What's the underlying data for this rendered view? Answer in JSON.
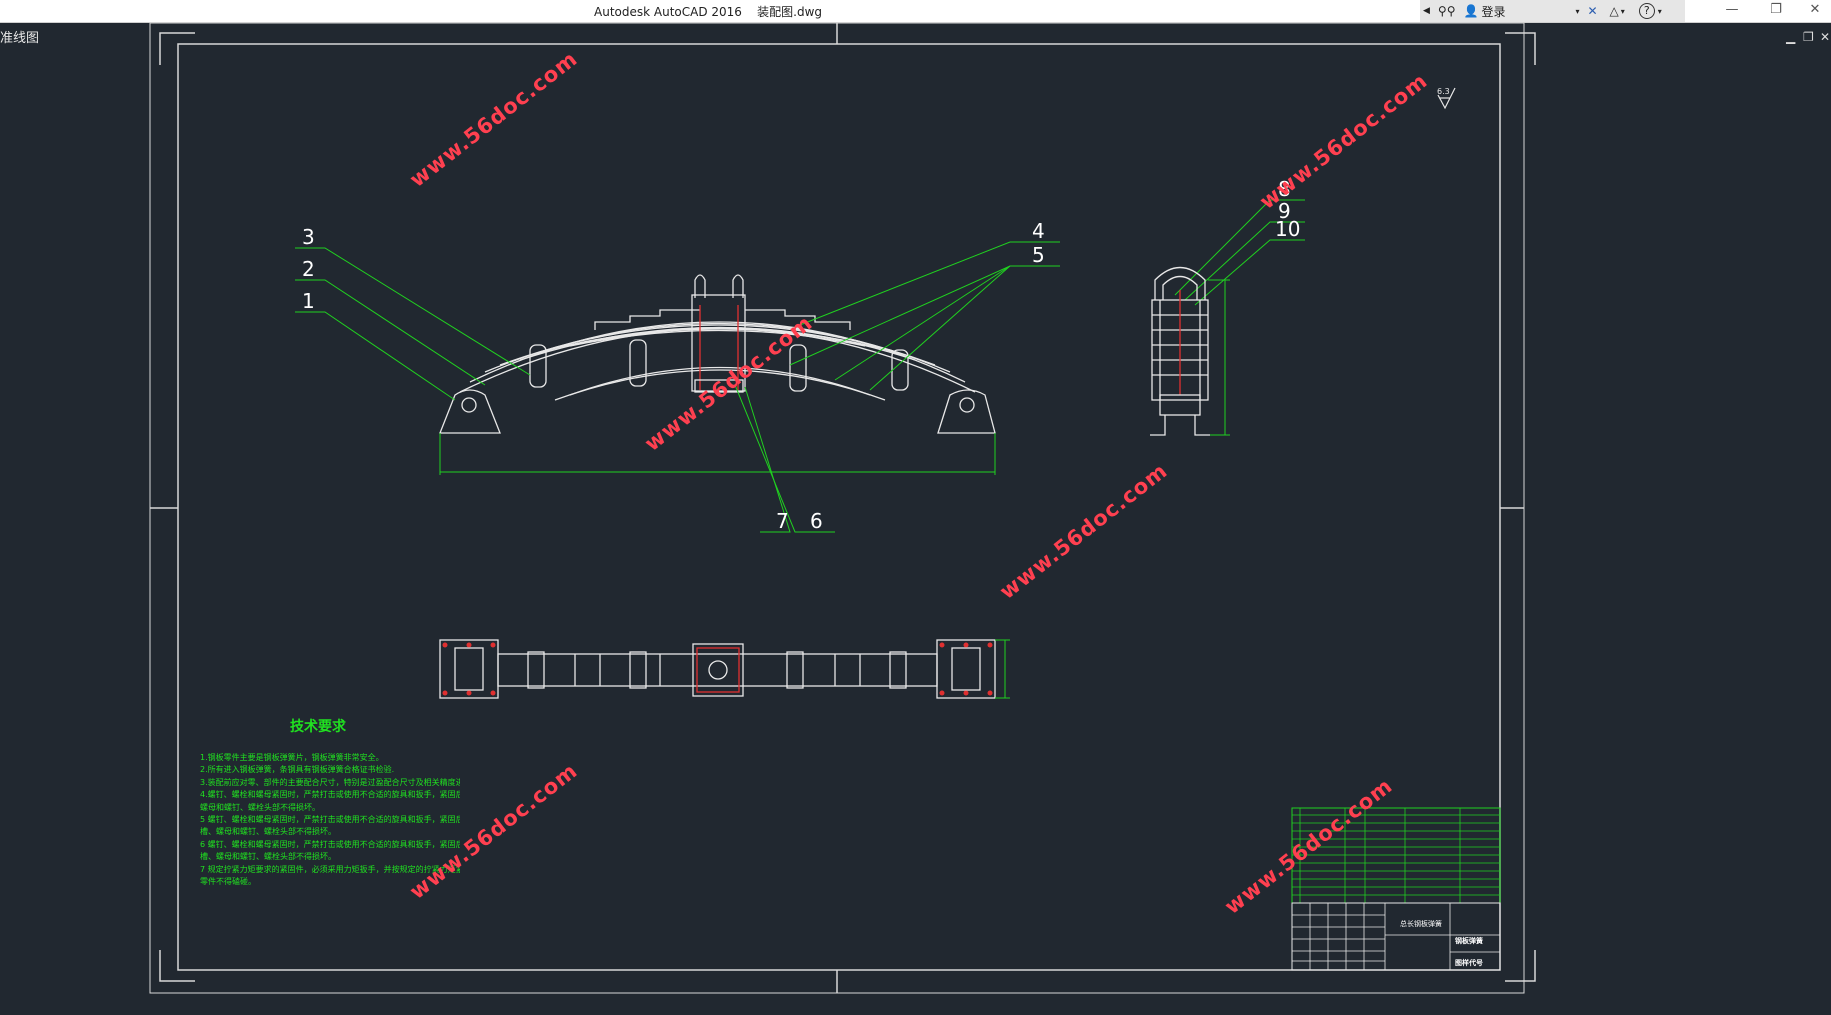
{
  "window": {
    "title": "Autodesk AutoCAD 2016    装配图.dwg",
    "signin_label": "登录",
    "help_label": "?"
  },
  "viewport": {
    "label": "准线图"
  },
  "drawing": {
    "roughness": "6.3",
    "balloons": [
      "1",
      "2",
      "3",
      "4",
      "5",
      "6",
      "7",
      "8",
      "9",
      "10"
    ],
    "tech_req_title": "技术要求",
    "tech_req_lines": [
      "1.钢板零件主要是钢板弹簧片，钢板弹簧非常安全。",
      "2.所有进入钢板弹簧，条钢具有钢板弹簧合格证书检验.",
      "3.装配前应对零、部件的主要配合尺寸，特别是过盈配合尺寸及相关精度进行复查。",
      "4.螺钉、螺栓和螺母紧固时，严禁打击或使用不合适的旋具和扳手，紧固后螺钉槽、",
      "螺母和螺钉、螺栓头部不得损坏。",
      "5    螺钉、螺栓和螺母紧固时，严禁打击或使用不合适的旋具和扳手，紧固后螺钉",
      "槽、螺母和螺钉、螺栓头部不得损坏。",
      "6    螺钉、螺栓和螺母紧固时，严禁打击或使用不合适的旋具和扳手，紧固后螺钉",
      "槽、螺母和螺钉、螺栓头部不得损坏。",
      "7    规定拧紧力矩要求的紧固件，必须采用力矩扳手，并按规定的拧紧力矩紧固。",
      "零件不得磕碰。"
    ],
    "title_block": {
      "drawing_name": "钢板弹簧",
      "drawing_code": "图样代号",
      "design_label": "总长钢板弹簧"
    }
  },
  "watermark": "www.56doc.com"
}
